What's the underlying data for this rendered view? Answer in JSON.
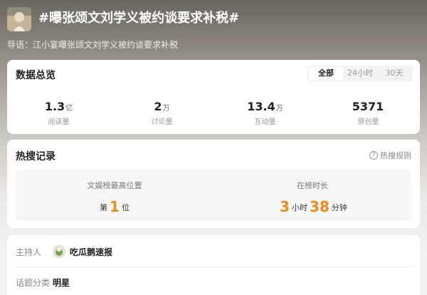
{
  "topic": {
    "title": "#曝张颂文刘学义被约谈要求补税#",
    "guide": "导语：江小宴曝张颂文刘学义被约谈要求补税"
  },
  "overview": {
    "title": "数据总览",
    "tabs": [
      {
        "label": "全部",
        "active": true
      },
      {
        "label": "24小时",
        "active": false
      },
      {
        "label": "30天",
        "active": false
      }
    ],
    "stats": [
      {
        "value": "1.3",
        "unit": "亿",
        "label": "阅读量"
      },
      {
        "value": "2",
        "unit": "万",
        "label": "讨论量"
      },
      {
        "value": "13.4",
        "unit": "万",
        "label": "互动量"
      },
      {
        "value": "5371",
        "unit": "",
        "label": "原创量"
      }
    ]
  },
  "hotsearch": {
    "title": "热搜记录",
    "rules_label": "热搜规则",
    "peak": {
      "label": "文娱榜最高位置",
      "prefix": "第",
      "value": "1",
      "suffix": "位"
    },
    "duration": {
      "label": "在榜时长",
      "hours": "3",
      "hours_unit": "小时",
      "minutes": "38",
      "minutes_unit": "分钟"
    }
  },
  "info": {
    "host_label": "主持人",
    "host_name": "吃瓜鹅速报",
    "category_label": "话题分类",
    "category_value": "明星"
  },
  "colors": {
    "accent": "#f08a1b"
  }
}
